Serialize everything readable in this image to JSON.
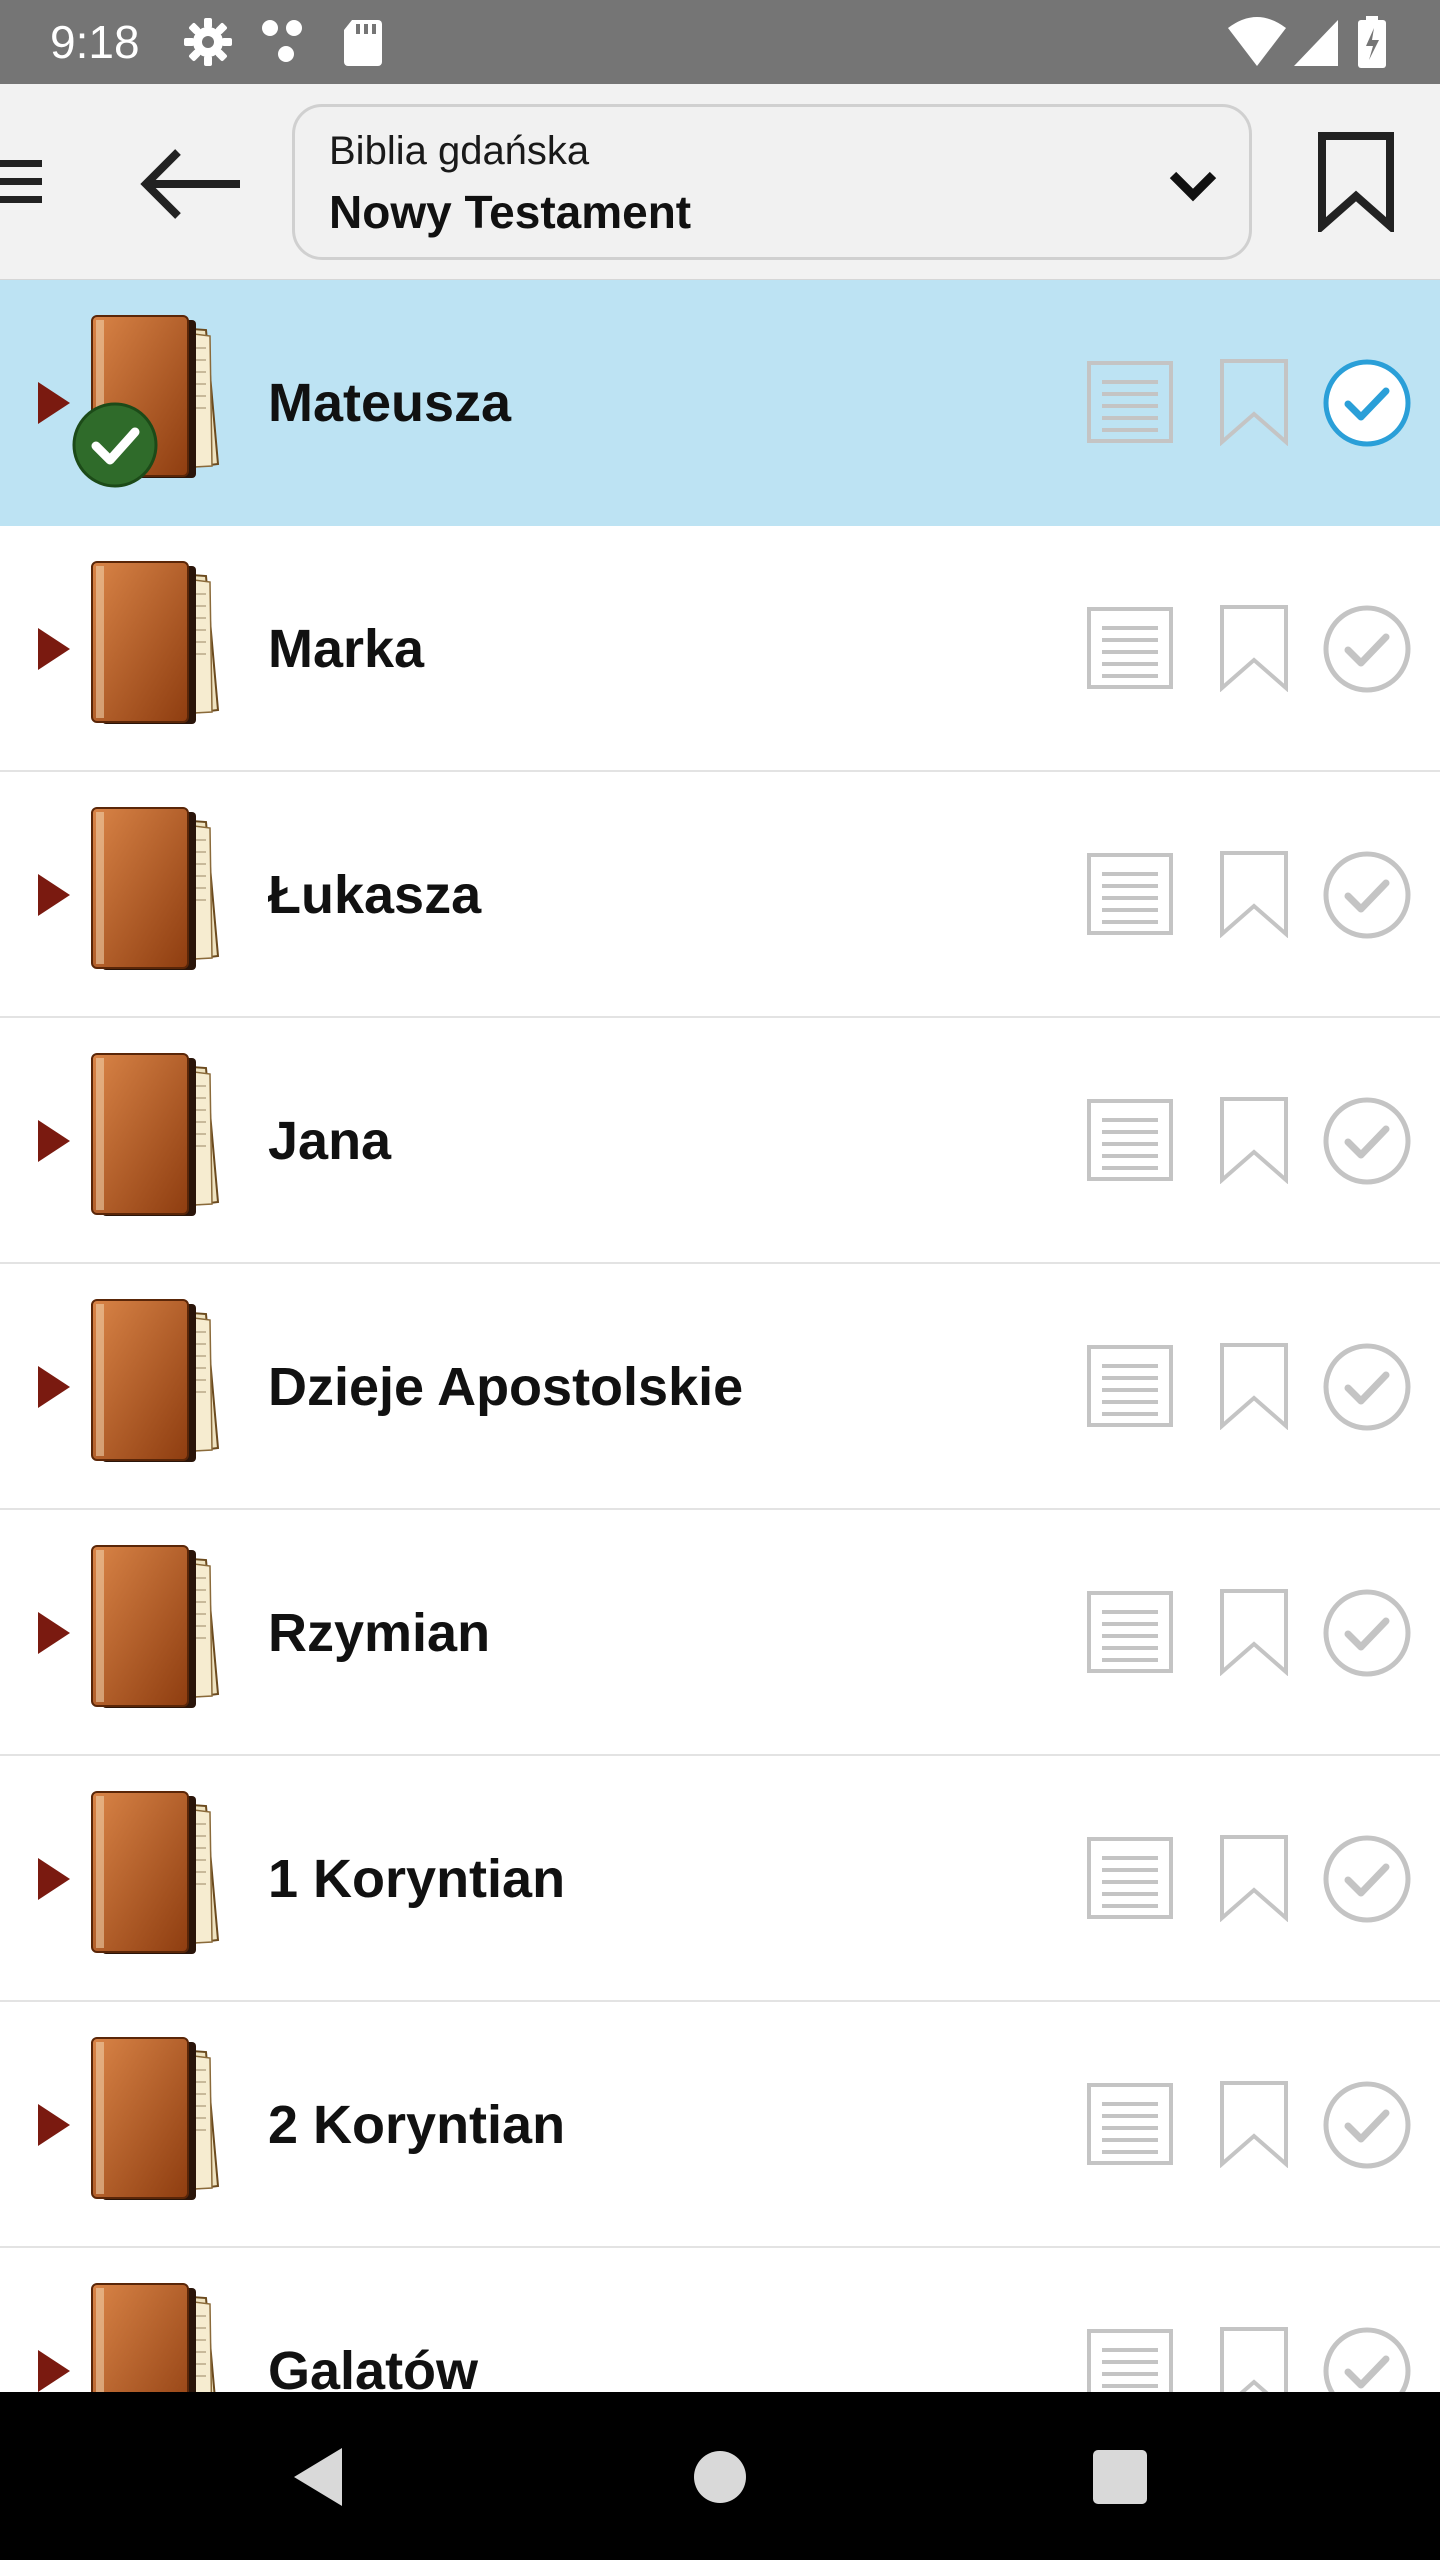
{
  "status_bar": {
    "time": "9:18"
  },
  "toolbar": {
    "selector": {
      "translation": "Biblia gdańska",
      "section": "Nowy Testament"
    }
  },
  "colors": {
    "selected_row": "#bde3f3",
    "accent": "#2a9fd8",
    "action_gray": "#c4c4c4",
    "book_brown": "#b85a1c",
    "badge_green": "#2f6b2a",
    "expand_arrow": "#7a1a10"
  },
  "books": [
    {
      "name": "Mateusza",
      "selected": true,
      "read": true
    },
    {
      "name": "Marka",
      "selected": false,
      "read": false
    },
    {
      "name": "Łukasza",
      "selected": false,
      "read": false
    },
    {
      "name": "Jana",
      "selected": false,
      "read": false
    },
    {
      "name": "Dzieje Apostolskie",
      "selected": false,
      "read": false
    },
    {
      "name": "Rzymian",
      "selected": false,
      "read": false
    },
    {
      "name": "1 Koryntian",
      "selected": false,
      "read": false
    },
    {
      "name": "2 Koryntian",
      "selected": false,
      "read": false
    },
    {
      "name": "Galatów",
      "selected": false,
      "read": false
    }
  ],
  "icons": {
    "status": [
      "gear-icon",
      "dots-icon",
      "sd-card-icon",
      "wifi-icon",
      "signal-icon",
      "battery-icon"
    ],
    "toolbar": [
      "menu-icon",
      "back-arrow-icon",
      "chevron-down-icon",
      "bookmark-icon"
    ],
    "row": [
      "expand-arrow-icon",
      "book-icon",
      "chapters-list-icon",
      "bookmark-outline-icon",
      "check-circle-icon"
    ],
    "nav": [
      "back-triangle-icon",
      "home-circle-icon",
      "recents-square-icon"
    ]
  }
}
